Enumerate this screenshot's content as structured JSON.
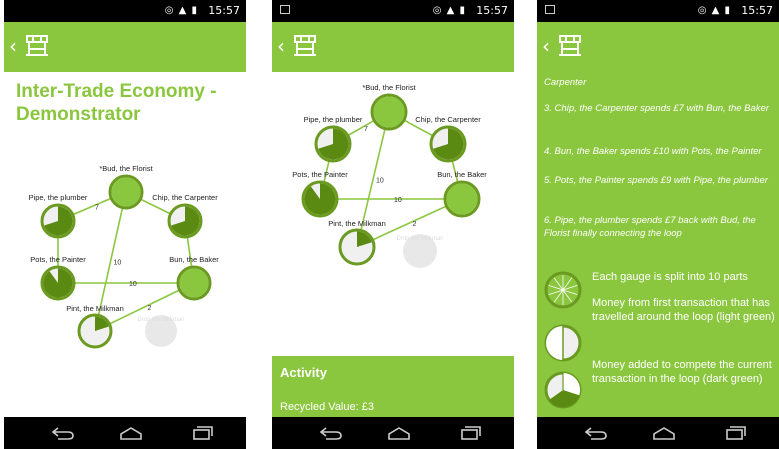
{
  "status_bar": {
    "time": "15:57"
  },
  "nav_buttons": [
    "back",
    "home",
    "recents"
  ],
  "screen1": {
    "page_title": "Inter-Trade Economy - Demonstrator"
  },
  "diagram": {
    "nodes": [
      {
        "id": "bud",
        "label": "*Bud, the Florist",
        "fill_fraction": 1.0
      },
      {
        "id": "pipe",
        "label": "Pipe, the plumber",
        "fill_fraction": 0.7
      },
      {
        "id": "chip",
        "label": "Chip, the Carpenter",
        "fill_fraction": 0.7
      },
      {
        "id": "pots",
        "label": "Pots, the Painter",
        "fill_fraction": 0.9
      },
      {
        "id": "bun",
        "label": "Bun, the Baker",
        "fill_fraction": 1.0
      },
      {
        "id": "pint",
        "label": "Pint, the Milkman",
        "fill_fraction": 0.2
      }
    ],
    "edge_values": {
      "bud_pint": "10",
      "bun_pots": "10",
      "pipe_bud": "7",
      "pint_bun": "2"
    },
    "faded_label": "Drop the Milkman"
  },
  "screen2": {
    "activity_title": "Activity",
    "recycled_value": "Recycled Value: £3"
  },
  "screen3": {
    "steps": [
      "Carpenter",
      "3. Chip, the Carpenter spends £7 with Bun, the Baker",
      "4. Bun, the Baker spends £10 with Pots, the Painter",
      "5. Pots, the Painter spends £9 with Pipe, the plumber",
      "6. Pipe, the plumber spends £7 back with Bud, the Florist finally connecting the loop"
    ],
    "legend": [
      {
        "icon": "ten-part-gauge-icon",
        "text": "Each gauge is split into 10 parts"
      },
      {
        "icon": "half-light-gauge-icon",
        "text": "Money from first transaction that has travelled around the loop (light green)"
      },
      {
        "icon": "dark-green-gauge-icon",
        "text": "Money added to compete the current transaction in the loop (dark green)"
      }
    ]
  },
  "colors": {
    "brand_green": "#8bc63f",
    "dark_green": "#5b8a12",
    "gauge_bg": "#f0f0f0",
    "gauge_ring": "#6a9a20"
  }
}
